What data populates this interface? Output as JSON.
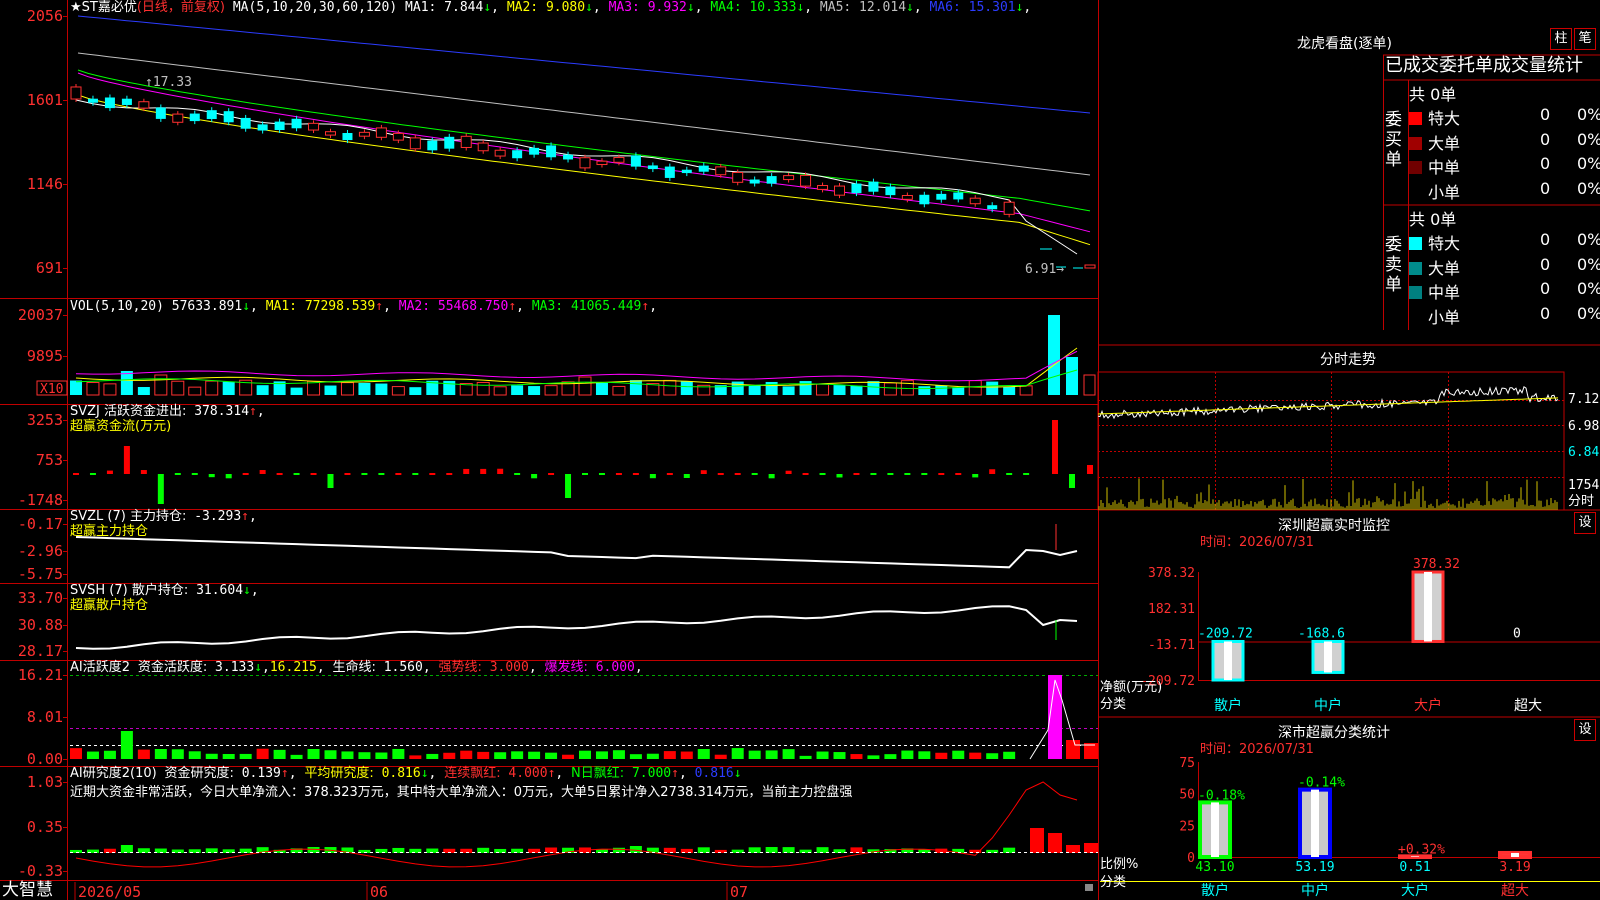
{
  "app": {
    "brand": "大智慧"
  },
  "header": {
    "stock": "★ST嘉必优",
    "period": "(日线，前复权)",
    "ma_label": "MA(5,10,20,30,60,120)",
    "ma": [
      {
        "label": "MA1:",
        "value": "7.844",
        "arrow": "↓",
        "color": "#ffffff"
      },
      {
        "label": "MA2:",
        "value": "9.080",
        "arrow": "↓",
        "color": "#ffff00"
      },
      {
        "label": "MA3:",
        "value": "9.932",
        "arrow": "↓",
        "color": "#ff00ff"
      },
      {
        "label": "MA4:",
        "value": "10.333",
        "arrow": "↓",
        "color": "#00ff00"
      },
      {
        "label": "MA5:",
        "value": "12.014",
        "arrow": "↓",
        "color": "#c0c0c0"
      },
      {
        "label": "MA6:",
        "value": "15.301",
        "arrow": "↓",
        "color": "#2c3cff"
      }
    ]
  },
  "price_panel": {
    "y_ticks": [
      "2056",
      "1601",
      "1146",
      "691"
    ],
    "high_label": "17.33",
    "low_label": "6.91"
  },
  "vol_panel": {
    "title": "VOL(5,10,20)",
    "value": "57633.891",
    "value_arrow": "↓",
    "ma": [
      {
        "label": "MA1:",
        "value": "77298.539",
        "arrow": "↑",
        "color": "#ffff00"
      },
      {
        "label": "MA2:",
        "value": "55468.750",
        "arrow": "↑",
        "color": "#ff00ff"
      },
      {
        "label": "MA3:",
        "value": "41065.449",
        "arrow": "↑",
        "color": "#00ff00"
      }
    ],
    "y_ticks": [
      "20037",
      "9895"
    ],
    "unit": "X10"
  },
  "svzj_panel": {
    "line1_label": "SVZJ  活跃资金进出:",
    "line1_value": "378.314",
    "line1_arrow": "↑",
    "line2": "超赢资金流(万元)",
    "y_ticks": [
      "3253",
      "753",
      "-1748"
    ]
  },
  "svzl_panel": {
    "line1_label": "SVZL (7) 主力持仓:",
    "line1_value": "-3.293",
    "line1_arrow": "↑",
    "line2": "超赢主力持仓",
    "y_ticks": [
      "-0.17",
      "-2.96",
      "-5.75"
    ]
  },
  "svsh_panel": {
    "line1_label": "SVSH (7) 散户持仓:",
    "line1_value": "31.604",
    "line1_arrow": "↓",
    "line2": "超赢散户持仓",
    "y_ticks": [
      "33.70",
      "30.88",
      "28.17"
    ]
  },
  "ai_active_panel": {
    "title": "AI活跃度2",
    "label1": "资金活跃度:",
    "value1": "3.133",
    "arrow1": "↓",
    "value2": "16.215",
    "label3": "生命线:",
    "value3": "1.560",
    "label4": "强势线:",
    "value4": "3.000",
    "label5": "爆发线:",
    "value5": "6.000",
    "y_ticks": [
      "16.21",
      "8.01",
      "0.00"
    ]
  },
  "ai_research_panel": {
    "title": "AI研究度2(10)",
    "label1": "资金研究度:",
    "value1": "0.139",
    "arrow1": "↑",
    "label2": "平均研究度:",
    "value2": "0.816",
    "arrow2": "↓",
    "label3": "连续飘红:",
    "value3": "4.000",
    "arrow3": "↑",
    "label4": "N日飘红:",
    "value4": "7.000",
    "arrow4": "↑",
    "value5": "0.816",
    "arrow5": "↓",
    "summary": "近期大资金非常活跃，今日大单净流入：378.323万元，其中特大单净流入：0万元，大单5日累计净入2738.314万元，当前主力控盘强",
    "y_ticks": [
      "1.03",
      "0.35",
      "-0.33"
    ]
  },
  "time_axis": [
    "2026/05",
    "06",
    "07"
  ],
  "right": {
    "longhu": {
      "title": "龙虎看盘(逐单)",
      "btn1": "柱",
      "btn2": "笔"
    },
    "order_stats": {
      "title": "已成交委托单成交量统计",
      "buy_label": "委买单",
      "sell_label": "委卖单",
      "buy_total": "共 0单",
      "sell_total": "共 0单",
      "buy_rows": [
        {
          "name": "特大",
          "count": "0",
          "pct": "0%",
          "color": "#ff0000"
        },
        {
          "name": "大单",
          "count": "0",
          "pct": "0%",
          "color": "#a00000"
        },
        {
          "name": "中单",
          "count": "0",
          "pct": "0%",
          "color": "#700000"
        },
        {
          "name": "小单",
          "count": "0",
          "pct": "0%",
          "color": ""
        }
      ],
      "sell_rows": [
        {
          "name": "特大",
          "count": "0",
          "pct": "0%",
          "color": "#00ffff"
        },
        {
          "name": "大单",
          "count": "0",
          "pct": "0%",
          "color": "#008c8c"
        },
        {
          "name": "中单",
          "count": "0",
          "pct": "0%",
          "color": "#008080"
        },
        {
          "name": "小单",
          "count": "0",
          "pct": "0%",
          "color": ""
        }
      ]
    },
    "intraday": {
      "title": "分时走势",
      "y_ticks": [
        "7.12",
        "6.98",
        "6.84"
      ],
      "vol_tick": "1754",
      "vol_unit": "分时"
    },
    "sz_monitor": {
      "title": "深圳超赢实时监控",
      "btn": "设",
      "time": "时间：2026/07/31",
      "y_ticks": [
        "378.32",
        "182.31",
        "-13.71",
        "-209.72"
      ],
      "ylabel": "净额(万元)",
      "xlabel": "分类",
      "categories": [
        "散户",
        "中户",
        "大户",
        "超大"
      ],
      "values": [
        -209.72,
        -168.6,
        378.32,
        0
      ],
      "value_labels": [
        "-209.72",
        "-168.6",
        "378.32",
        "0"
      ]
    },
    "sz_class": {
      "title": "深市超赢分类统计",
      "btn": "设",
      "time": "时间：2026/07/31",
      "y_ticks": [
        "75",
        "50",
        "25",
        "0"
      ],
      "ylabel": "比例%",
      "xlabel": "分类",
      "categories": [
        "散户",
        "中户",
        "大户",
        "超大"
      ],
      "values": [
        43.1,
        53.19,
        0.51,
        3.19
      ],
      "value_labels": [
        "43.10",
        "53.19",
        "0.51",
        "3.19"
      ],
      "change_labels": [
        "-0.18%",
        "-0.14%",
        "+0.32%",
        ""
      ]
    }
  },
  "chart_data": {
    "type": "bar",
    "title": "深圳超赢实时监控",
    "categories": [
      "散户",
      "中户",
      "大户",
      "超大"
    ],
    "series": [
      {
        "name": "净额(万元)",
        "values": [
          -209.72,
          -168.6,
          378.32,
          0
        ]
      },
      {
        "name": "比例%",
        "values": [
          43.1,
          53.19,
          0.51,
          3.19
        ]
      }
    ],
    "ylabel": "净额(万元)",
    "ylim": [
      -209.72,
      378.32
    ]
  },
  "colors": {
    "up": "#ff3030",
    "down": "#00ffff",
    "grid_red": "#c00000",
    "pos": "#ff0000",
    "neg": "#00ff00"
  }
}
